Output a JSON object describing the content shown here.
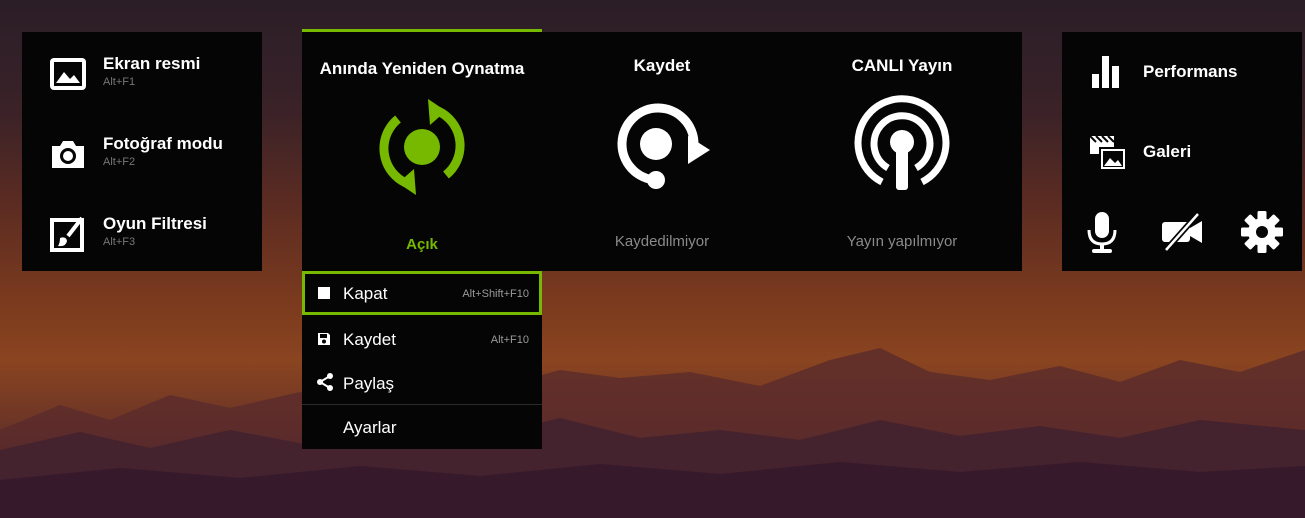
{
  "left_panel": {
    "items": [
      {
        "label": "Ekran resmi",
        "shortcut": "Alt+F1",
        "icon": "image-icon"
      },
      {
        "label": "Fotoğraf modu",
        "shortcut": "Alt+F2",
        "icon": "camera-icon"
      },
      {
        "label": "Oyun Filtresi",
        "shortcut": "Alt+F3",
        "icon": "filter-brush-icon"
      }
    ]
  },
  "features": [
    {
      "title": "Anında Yeniden Oynatma",
      "status": "Açık",
      "icon": "instant-replay-icon"
    },
    {
      "title": "Kaydet",
      "status": "Kaydedilmiyor",
      "icon": "record-icon"
    },
    {
      "title": "CANLI Yayın",
      "status": "Yayın yapılmıyor",
      "icon": "broadcast-icon"
    }
  ],
  "dropdown": {
    "items": [
      {
        "label": "Kapat",
        "shortcut": "Alt+Shift+F10",
        "icon": "stop-icon"
      },
      {
        "label": "Kaydet",
        "shortcut": "Alt+F10",
        "icon": "save-icon"
      },
      {
        "label": "Paylaş",
        "shortcut": "",
        "icon": "share-icon"
      },
      {
        "label": "Ayarlar",
        "shortcut": "",
        "icon": ""
      }
    ]
  },
  "right_panel": {
    "items": [
      {
        "label": "Performans",
        "icon": "performance-bars-icon"
      },
      {
        "label": "Galeri",
        "icon": "gallery-icon"
      }
    ],
    "bottom_icons": [
      "microphone-icon",
      "camera-off-icon",
      "gear-icon"
    ]
  },
  "colors": {
    "accent": "#76b900",
    "panel": "#050505",
    "muted": "#8a8a8a"
  }
}
